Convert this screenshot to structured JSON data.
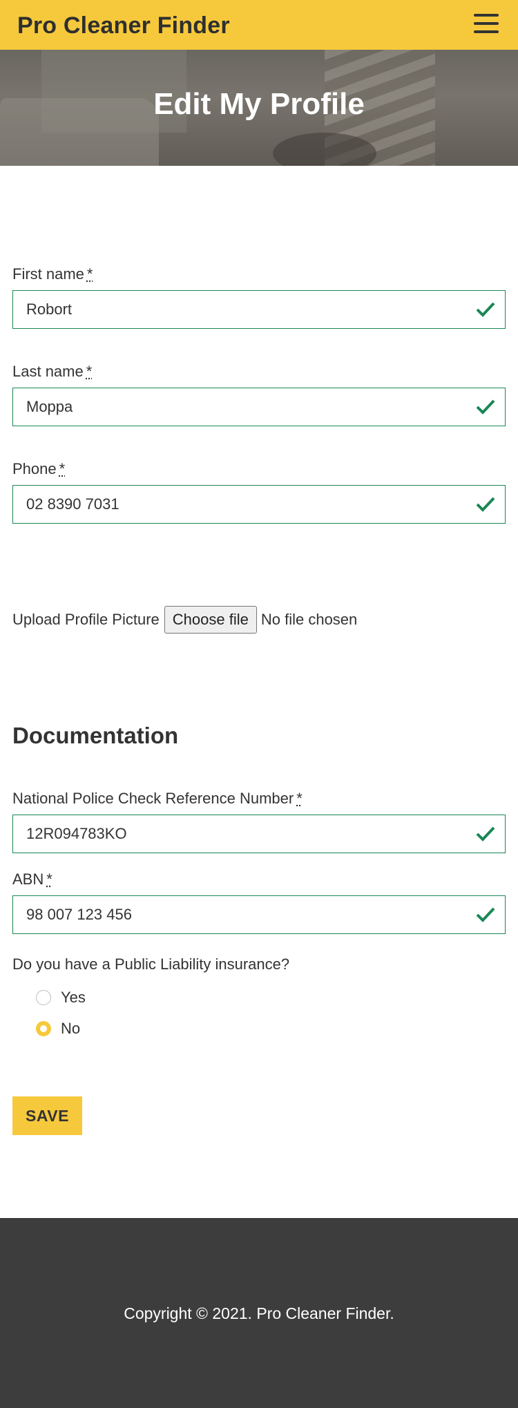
{
  "navbar": {
    "brand": "Pro Cleaner Finder",
    "menu_icon": "hamburger-icon"
  },
  "hero": {
    "title": "Edit My Profile"
  },
  "form": {
    "required_marker": "*",
    "first_name": {
      "label": "First name",
      "value": "Robort"
    },
    "last_name": {
      "label": "Last name",
      "value": "Moppa"
    },
    "phone": {
      "label": "Phone",
      "value": "02 8390 7031"
    },
    "upload": {
      "label": "Upload Profile Picture",
      "button": "Choose file",
      "status": "No file chosen"
    }
  },
  "documentation": {
    "heading": "Documentation",
    "police_check": {
      "label": "National Police Check Reference Number",
      "value": "12R094783KO"
    },
    "abn": {
      "label": "ABN",
      "value": "98 007 123 456"
    },
    "insurance": {
      "question": "Do you have a Public Liability insurance?",
      "options": [
        {
          "label": "Yes",
          "checked": false
        },
        {
          "label": "No",
          "checked": true
        }
      ]
    }
  },
  "actions": {
    "save": "SAVE"
  },
  "footer": {
    "copyright": "Copyright © 2021. Pro Cleaner Finder."
  },
  "colors": {
    "accent": "#f6c93c",
    "valid": "#198754",
    "footer_bg": "#3d3d3d"
  }
}
